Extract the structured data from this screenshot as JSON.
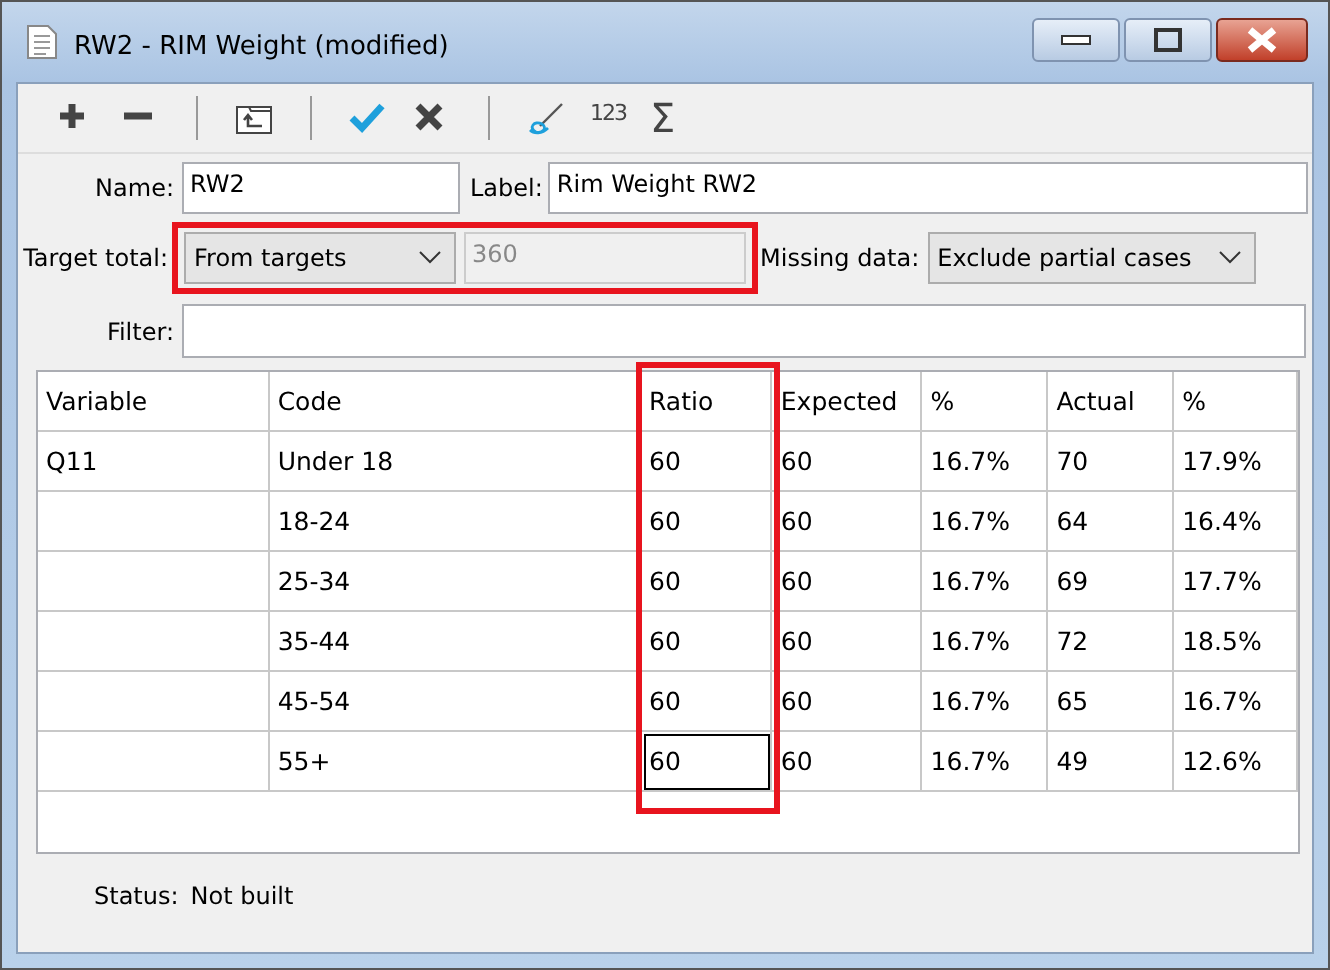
{
  "window": {
    "title": "RW2 - RIM Weight (modified)"
  },
  "toolbar": {
    "items": [
      {
        "kind": "plus"
      },
      {
        "kind": "minus"
      },
      {
        "kind": "sep"
      },
      {
        "kind": "folder-up"
      },
      {
        "kind": "sep"
      },
      {
        "kind": "check"
      },
      {
        "kind": "cross"
      },
      {
        "kind": "sep"
      },
      {
        "kind": "brush"
      },
      {
        "kind": "text",
        "text": "123"
      },
      {
        "kind": "text",
        "text": "Σ"
      }
    ]
  },
  "form": {
    "name_label": "Name:",
    "name": "RW2",
    "label_label": "Label:",
    "label": "Rim Weight RW2",
    "target_label": "Target total:",
    "target_mode": "From targets",
    "target_value": "360",
    "target_disabled": true,
    "target_highlighted": true,
    "missing_label": "Missing data:",
    "missing": "Exclude partial cases",
    "filter_label": "Filter:"
  },
  "table": {
    "columns": [
      {
        "label": "Variable",
        "highlighted": false
      },
      {
        "label": "Code",
        "highlighted": false
      },
      {
        "label": "Ratio",
        "highlighted": true
      },
      {
        "label": "Expected",
        "highlighted": false
      },
      {
        "label": "%",
        "highlighted": false
      },
      {
        "label": "Actual",
        "highlighted": false
      },
      {
        "label": "%",
        "highlighted": false
      }
    ],
    "rows": [
      {
        "cells": [
          "Q11",
          "Under 18",
          "60",
          "60",
          "16.7%",
          "70",
          "17.9%"
        ],
        "editing": false
      },
      {
        "cells": [
          "",
          "18-24",
          "60",
          "60",
          "16.7%",
          "64",
          "16.4%"
        ],
        "editing": false
      },
      {
        "cells": [
          "",
          "25-34",
          "60",
          "60",
          "16.7%",
          "69",
          "17.7%"
        ],
        "editing": false
      },
      {
        "cells": [
          "",
          "35-44",
          "60",
          "60",
          "16.7%",
          "72",
          "18.5%"
        ],
        "editing": false
      },
      {
        "cells": [
          "",
          "45-54",
          "60",
          "60",
          "16.7%",
          "65",
          "16.7%"
        ],
        "editing": false
      },
      {
        "cells": [
          "",
          "55+",
          "60",
          "60",
          "16.7%",
          "49",
          "12.6%"
        ],
        "editing": true
      }
    ]
  },
  "status_bar": {
    "label": "Status:",
    "value": "Not built"
  }
}
